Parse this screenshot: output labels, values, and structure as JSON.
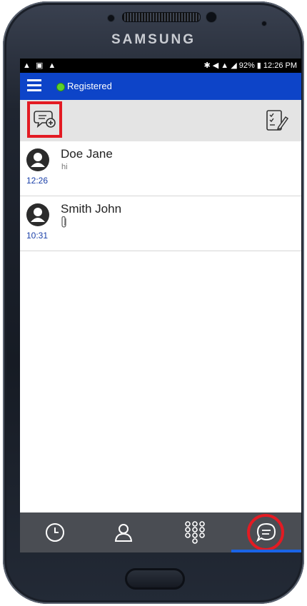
{
  "device": {
    "brand": "SAMSUNG"
  },
  "status_bar": {
    "left_icons": "▲ ▣ ▲",
    "right_text": "✱ ◀ ▲ ◢ 92% ▮ 12:26 PM"
  },
  "app_bar": {
    "status_label": "Registered"
  },
  "conversations": [
    {
      "name": "Doe Jane",
      "preview": "hi",
      "time": "12:26",
      "attachment": false
    },
    {
      "name": "Smith John",
      "preview": "",
      "time": "10:31",
      "attachment": true
    }
  ],
  "bottom_tabs": [
    {
      "icon": "clock-icon"
    },
    {
      "icon": "contact-icon"
    },
    {
      "icon": "dialpad-icon"
    },
    {
      "icon": "chat-icon",
      "active": true
    }
  ],
  "colors": {
    "app_bar": "#0d44c8",
    "registered_dot": "#5bd22b",
    "highlight": "#e31b23",
    "time_text": "#1a3fa8",
    "bottom_bar": "#4a4d53"
  }
}
